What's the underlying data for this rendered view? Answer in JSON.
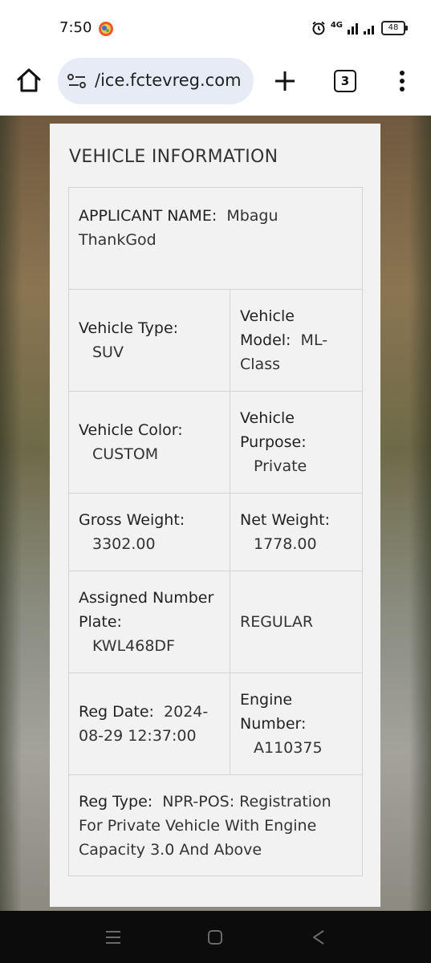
{
  "status": {
    "time": "7:50",
    "network": "4G",
    "battery": "48"
  },
  "browser": {
    "url": "/ice.fctevreg.com",
    "tab_count": "3"
  },
  "card": {
    "title": "VEHICLE INFORMATION",
    "applicant": {
      "label": "APPLICANT NAME:",
      "value": "Mbagu ThankGod"
    },
    "vehicle_type": {
      "label": "Vehicle Type:",
      "value": "SUV"
    },
    "vehicle_model": {
      "label": "Vehicle Model:",
      "value": "ML-Class"
    },
    "vehicle_color": {
      "label": "Vehicle Color:",
      "value": "CUSTOM"
    },
    "vehicle_purpose": {
      "label": "Vehicle Purpose:",
      "value": "Private"
    },
    "gross_weight": {
      "label": "Gross Weight:",
      "value": "3302.00"
    },
    "net_weight": {
      "label": "Net Weight:",
      "value": "1778.00"
    },
    "plate": {
      "label": "Assigned Number Plate:",
      "value": "KWL468DF"
    },
    "plate_type": {
      "value": "REGULAR"
    },
    "reg_date": {
      "label": "Reg Date:",
      "value": "2024-08-29 12:37:00"
    },
    "engine_number": {
      "label": "Engine Number:",
      "value": "A110375"
    },
    "reg_type": {
      "label": "Reg Type:",
      "value": "NPR-POS: Registration For Private Vehicle With Engine Capacity 3.0 And Above"
    }
  },
  "colors": {
    "url_pill": "#e6ebf5",
    "card_bg": "#f2f2f2",
    "cell_border": "#d4d4d4",
    "nav_bar": "#0c0c0c"
  },
  "icons": [
    "alarm-icon",
    "signal-icon",
    "battery-icon",
    "home-icon",
    "site-settings-icon",
    "plus-icon",
    "tabs-icon",
    "more-vert-icon",
    "recents-icon",
    "nav-home-icon",
    "back-icon"
  ]
}
